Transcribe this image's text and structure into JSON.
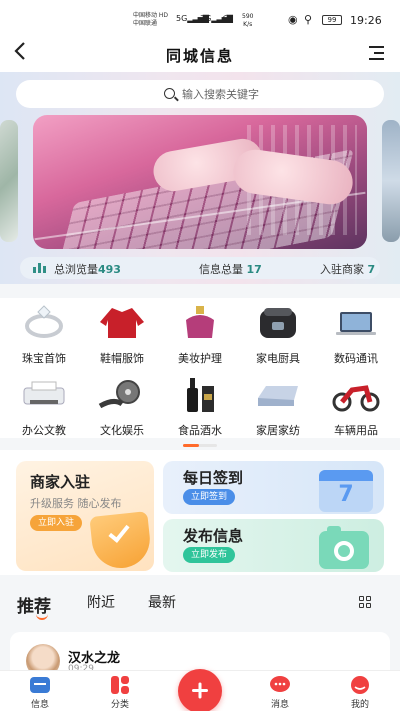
{
  "status_bar": {
    "carrier_1": "中国移动 HD",
    "carrier_2": "中国联通",
    "signal_1": "5G",
    "signal_2": "3G",
    "net_speed_value": "590",
    "net_speed_unit": "K/s",
    "battery": "99",
    "time": "19:26"
  },
  "header": {
    "title": "同城信息",
    "back_icon": "chevron-left-icon",
    "menu_icon": "menu-icon"
  },
  "search": {
    "placeholder": "输入搜索关键字"
  },
  "stats": {
    "views_label": "总浏览量",
    "views_value": "493",
    "info_label": "信息总量",
    "info_value": "17",
    "merchants_label": "入驻商家",
    "merchants_value": "7"
  },
  "categories": [
    {
      "label": "珠宝首饰",
      "icon": "ring-icon"
    },
    {
      "label": "鞋帽服饰",
      "icon": "jacket-icon"
    },
    {
      "label": "美妆护理",
      "icon": "perfume-icon"
    },
    {
      "label": "家电厨具",
      "icon": "rice-cooker-icon"
    },
    {
      "label": "数码通讯",
      "icon": "laptop-icon"
    },
    {
      "label": "办公文教",
      "icon": "printer-icon"
    },
    {
      "label": "文化娱乐",
      "icon": "film-reel-icon"
    },
    {
      "label": "食品酒水",
      "icon": "wine-bottle-icon"
    },
    {
      "label": "家居家纺",
      "icon": "bedding-icon"
    },
    {
      "label": "车辆用品",
      "icon": "motorcycle-icon"
    }
  ],
  "promo": {
    "merchant": {
      "title": "商家入驻",
      "subtitle": "升级服务 随心发布",
      "button": "立即入驻"
    },
    "checkin": {
      "title": "每日签到",
      "button": "立即签到",
      "calendar_day": "7"
    },
    "publish": {
      "title": "发布信息",
      "button": "立即发布"
    }
  },
  "feed_tabs": [
    {
      "label": "推荐",
      "active": true
    },
    {
      "label": "附近",
      "active": false
    },
    {
      "label": "最新",
      "active": false
    }
  ],
  "post": {
    "author": "汉水之龙",
    "time": "09:29"
  },
  "tabbar": [
    {
      "label": "信息",
      "icon": "info-icon"
    },
    {
      "label": "分类",
      "icon": "category-icon"
    },
    {
      "label": "",
      "icon": "plus-icon"
    },
    {
      "label": "消息",
      "icon": "message-icon"
    },
    {
      "label": "我的",
      "icon": "profile-icon"
    }
  ],
  "colors": {
    "accent": "#2a8a82",
    "orange": "#ff6a2a",
    "red": "#f04040",
    "blue": "#5a9af1",
    "green": "#2fc49a"
  }
}
